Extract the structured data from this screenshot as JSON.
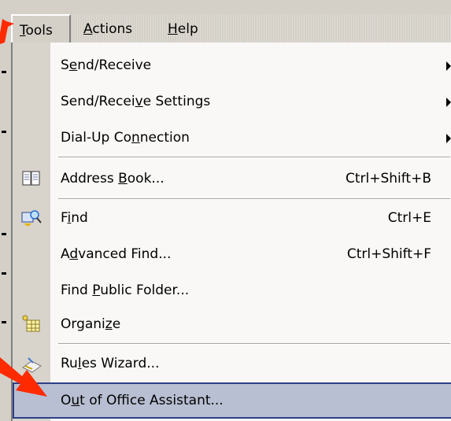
{
  "menubar": {
    "items": [
      {
        "pre": "",
        "u": "T",
        "post": "ools"
      },
      {
        "pre": "",
        "u": "A",
        "post": "ctions"
      },
      {
        "pre": "",
        "u": "H",
        "post": "elp"
      }
    ]
  },
  "dropdown": {
    "items": [
      {
        "pre": "S",
        "u": "e",
        "post": "nd/Receive",
        "shortcut": "",
        "submenu": true
      },
      {
        "pre": "Send/Recei",
        "u": "v",
        "post": "e Settings",
        "shortcut": "",
        "submenu": true
      },
      {
        "pre": "Dial-Up Co",
        "u": "n",
        "post": "nection",
        "shortcut": "",
        "submenu": true
      },
      {
        "pre": "Address ",
        "u": "B",
        "post": "ook...",
        "shortcut": "Ctrl+Shift+B",
        "icon": "address-book-icon"
      },
      {
        "pre": "F",
        "u": "i",
        "post": "nd",
        "shortcut": "Ctrl+E",
        "icon": "find-icon"
      },
      {
        "pre": "A",
        "u": "d",
        "post": "vanced Find...",
        "shortcut": "Ctrl+Shift+F"
      },
      {
        "pre": "Find ",
        "u": "P",
        "post": "ublic Folder...",
        "shortcut": ""
      },
      {
        "pre": "Organi",
        "u": "z",
        "post": "e",
        "shortcut": "",
        "icon": "organize-icon"
      },
      {
        "pre": "Ru",
        "u": "l",
        "post": "es Wizard...",
        "shortcut": "",
        "icon": "rules-wizard-icon"
      },
      {
        "pre": "O",
        "u": "u",
        "post": "t of Office Assistant...",
        "shortcut": "",
        "highlighted": true
      }
    ]
  },
  "annotation": {
    "color": "#ff2a00"
  }
}
